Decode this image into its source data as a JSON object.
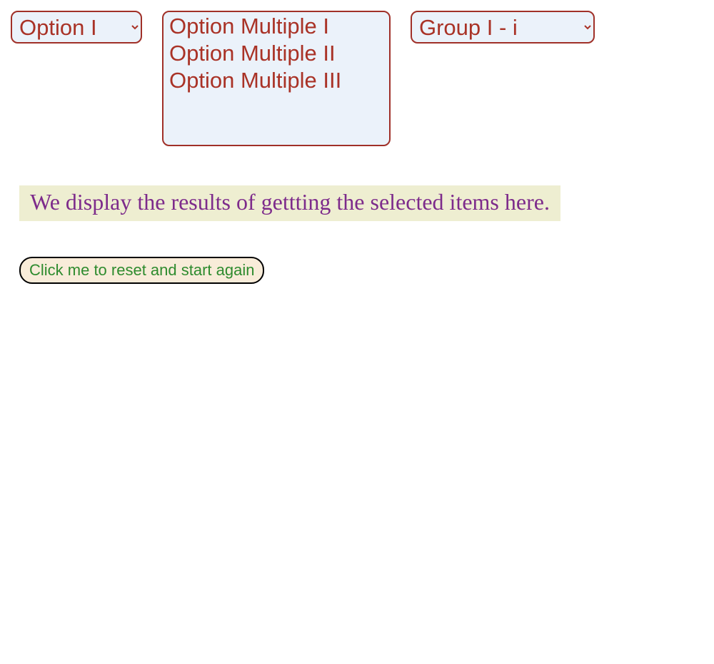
{
  "select_single": {
    "selected": "Option I",
    "options": [
      "Option I"
    ]
  },
  "select_multi": {
    "options": [
      "Option Multiple I",
      "Option Multiple II",
      "Option Multiple III"
    ]
  },
  "select_group": {
    "selected": "Group I - i",
    "options": [
      "Group I - i"
    ]
  },
  "results_text": "We display the results of gettting the selected items here.",
  "reset_button_label": "Click me to reset and start again"
}
